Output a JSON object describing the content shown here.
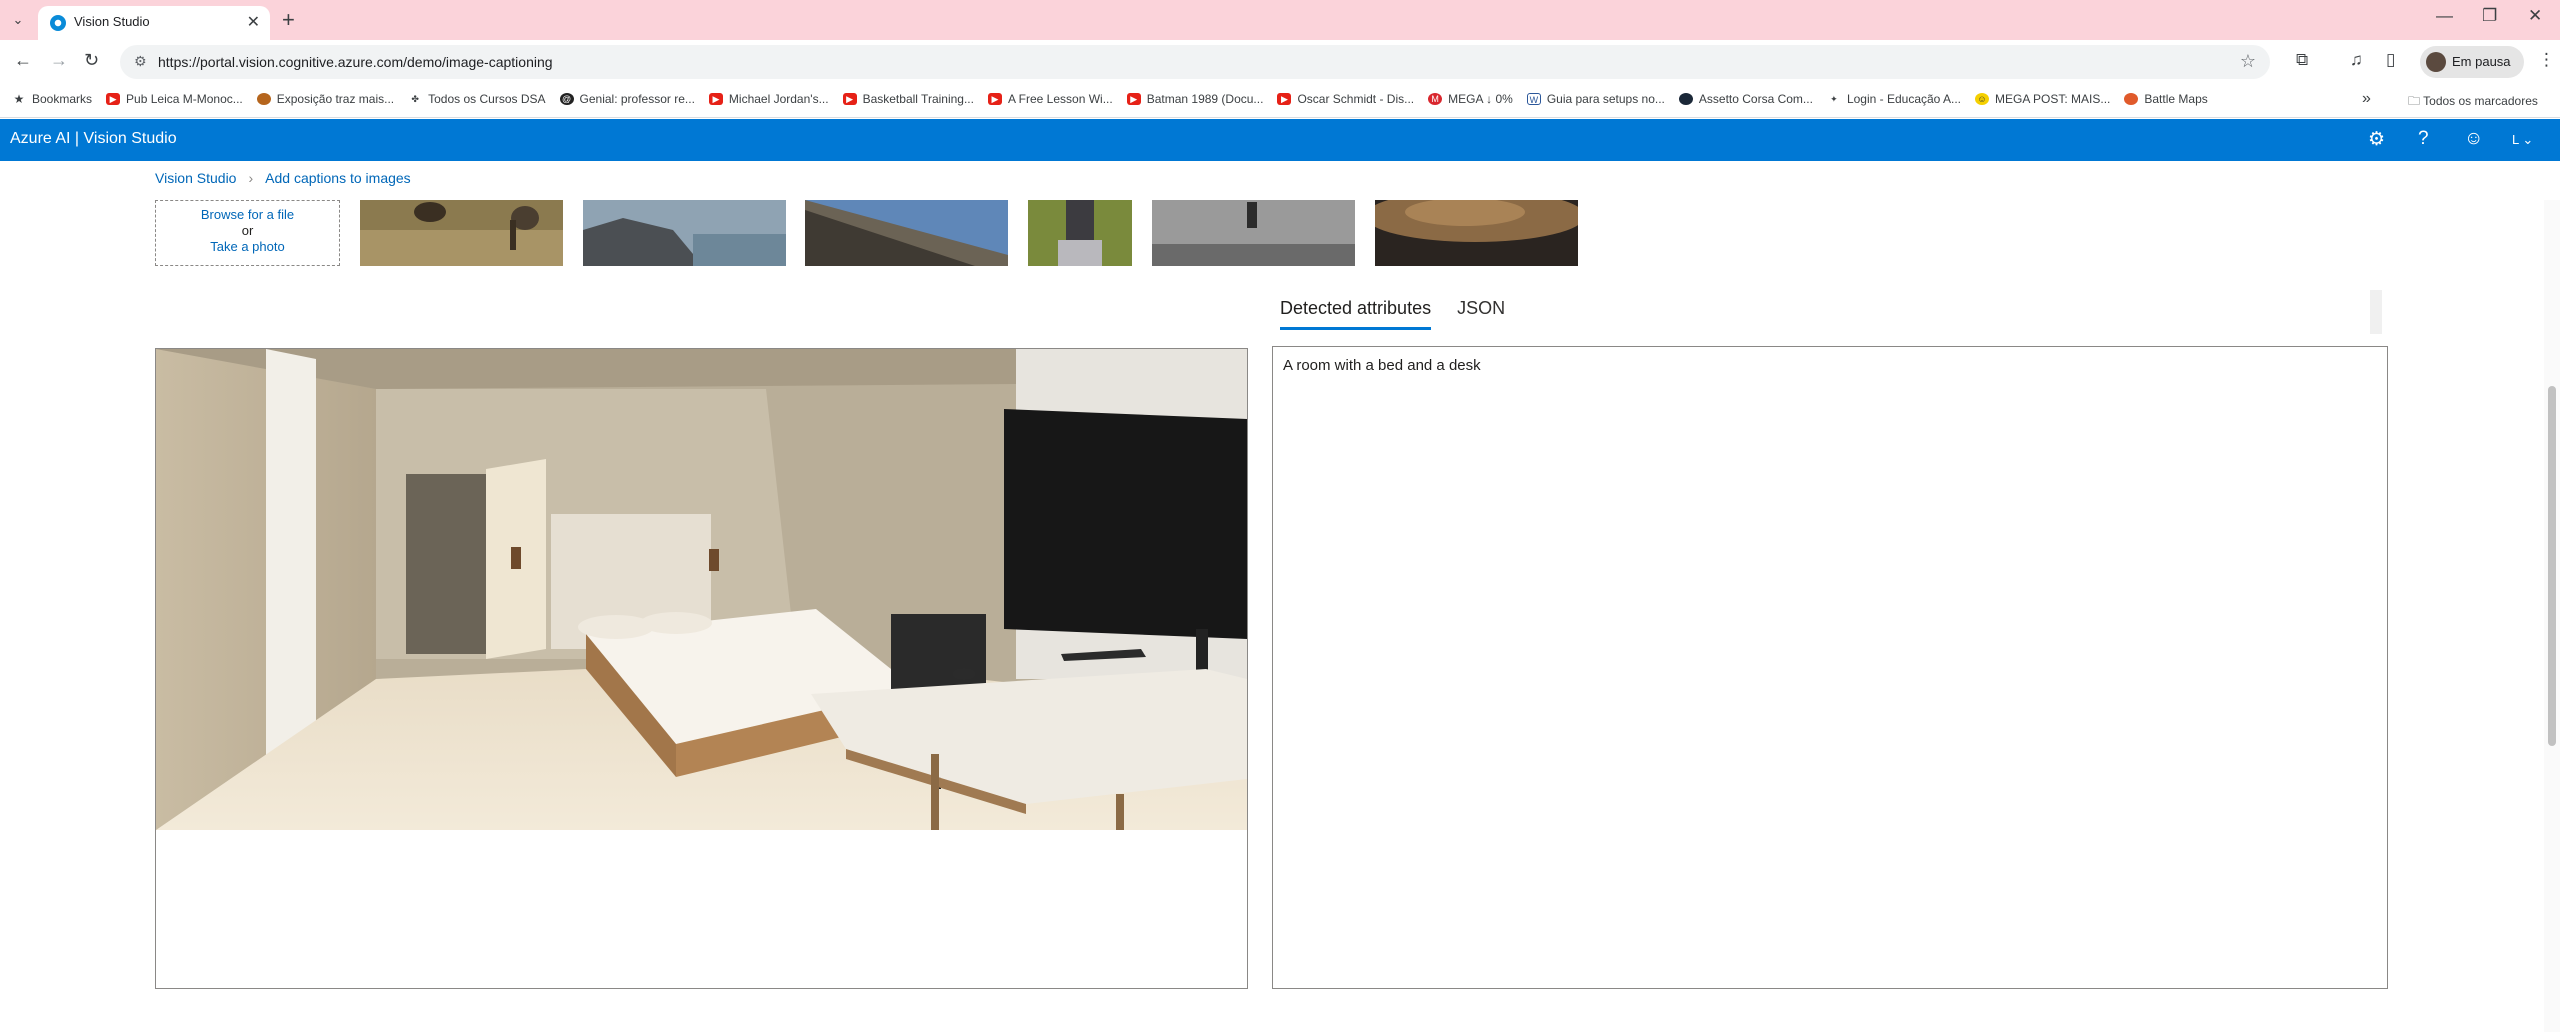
{
  "browser": {
    "tab_title": "Vision Studio",
    "url": "https://portal.vision.cognitive.azure.com/demo/image-captioning",
    "profile_label": "Em pausa",
    "bookmarks": [
      "Bookmarks",
      "Pub Leica M-Monoc...",
      "Exposição traz mais...",
      "Todos os Cursos DSA",
      "Genial: professor re...",
      "Michael Jordan's...",
      "Basketball Training...",
      "A Free Lesson Wi...",
      "Batman 1989 (Docu...",
      "Oscar Schmidt - Dis...",
      "MEGA ↓ 0%",
      "Guia para setups no...",
      "Assetto Corsa Com...",
      "Login - Educação A...",
      "MEGA POST: MAIS...",
      "Battle Maps"
    ],
    "all_bookmarks": "Todos os marcadores"
  },
  "header": {
    "brand": "Azure AI  |  Vision Studio",
    "user_initial": "L"
  },
  "breadcrumb": {
    "root": "Vision Studio",
    "current": "Add captions to images"
  },
  "upload": {
    "browse": "Browse for a file",
    "or": "or",
    "take_photo": "Take a photo"
  },
  "tabs": [
    "Detected attributes",
    "JSON"
  ],
  "active_tab": "Detected attributes",
  "result": {
    "caption": "A room with a bed and a desk"
  },
  "colors": {
    "accent": "#0078d4",
    "tabstrip": "#fbd3da",
    "link": "#0067b8"
  }
}
